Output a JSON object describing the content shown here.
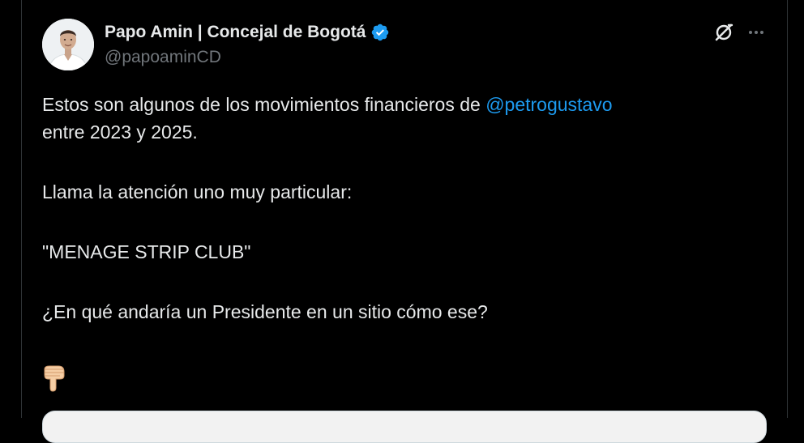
{
  "tweet": {
    "author": {
      "display_name": "Papo Amin | Concejal de Bogotá",
      "handle": "@papoaminCD",
      "verified_icon": "verified-badge-icon",
      "avatar": "profile-photo"
    },
    "header_actions": {
      "grok_icon": "grok-icon",
      "more_icon": "more-options-icon"
    },
    "text": {
      "line1_before": "Estos son algunos de los movimientos financieros de ",
      "mention": "@petrogustavo",
      "line1_after": "entre 2023 y 2025.",
      "paragraph2": "Llama la atención uno muy particular:",
      "paragraph3": "\"MENAGE STRIP CLUB\"",
      "paragraph4": "¿En qué andaría un Presidente en un sitio cómo ese?"
    },
    "emoji": "backhand-index-pointing-down",
    "colors": {
      "background": "#000000",
      "text": "#e7e9ea",
      "secondary": "#71767b",
      "link": "#1d9bf0",
      "border": "#2f3336"
    }
  }
}
